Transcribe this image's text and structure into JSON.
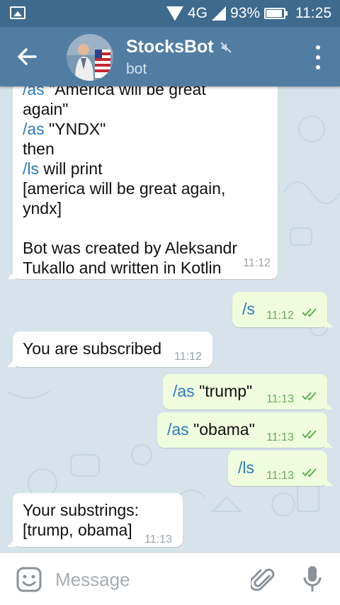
{
  "status_bar": {
    "network": "4G",
    "battery": "93%",
    "time": "11:25"
  },
  "header": {
    "title": "StocksBot",
    "subtitle": "bot"
  },
  "messages": {
    "long": {
      "lines": [
        {
          "cmd": "/as",
          "text": " \"America will be great"
        },
        {
          "cmd": "",
          "text": "again\""
        },
        {
          "cmd": "/as",
          "text": " \"YNDX\""
        },
        {
          "cmd": "",
          "text": "then"
        },
        {
          "cmd": "/ls",
          "text": " will print"
        },
        {
          "cmd": "",
          "text": "[america will be great again,"
        },
        {
          "cmd": "",
          "text": "yndx]"
        },
        {
          "cmd": "",
          "text": ""
        },
        {
          "cmd": "",
          "text": "Bot was created by Aleksandr"
        },
        {
          "cmd": "",
          "text": "Tukallo and written in Kotlin"
        }
      ],
      "time": "11:12"
    },
    "s": {
      "cmd": "/s",
      "time": "11:12"
    },
    "subscribed": {
      "text": "You are subscribed",
      "time": "11:12"
    },
    "trump": {
      "cmd": "/as",
      "text": " \"trump\"",
      "time": "11:13"
    },
    "obama": {
      "cmd": "/as",
      "text": " \"obama\"",
      "time": "11:13"
    },
    "ls": {
      "cmd": "/ls",
      "time": "11:13"
    },
    "substrings": {
      "line1": "Your substrings:",
      "line2": "[trump, obama]",
      "time": "11:13"
    }
  },
  "input": {
    "placeholder": "Message"
  },
  "colors": {
    "status_bar": "#3e6a8e",
    "app_bar": "#527da3",
    "incoming_bubble": "#ffffff",
    "outgoing_bubble": "#effdde",
    "command_link": "#2b7bbd",
    "read_ticks": "#5fb14f"
  },
  "icons": [
    "gallery-icon",
    "wifi-icon",
    "signal-icon",
    "battery-icon",
    "back-arrow-icon",
    "mute-icon",
    "more-vert-icon",
    "double-check-icon",
    "emoji-icon",
    "attach-icon",
    "mic-icon"
  ]
}
